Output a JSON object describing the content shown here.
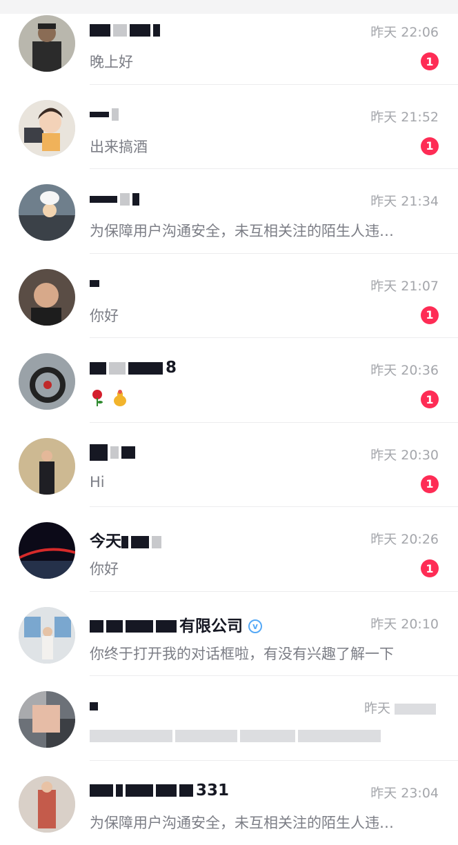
{
  "messages": [
    {
      "name_visible": "",
      "time": "昨天 22:06",
      "preview": "晚上好",
      "unread": "1"
    },
    {
      "name_visible": "",
      "time": "昨天 21:52",
      "preview": "出来搞酒",
      "unread": "1"
    },
    {
      "name_visible": "",
      "time": "昨天 21:34",
      "preview": "为保障用户沟通安全，未互相关注的陌生人违…",
      "unread": ""
    },
    {
      "name_visible": "",
      "time": "昨天 21:07",
      "preview": "你好",
      "unread": "1"
    },
    {
      "name_visible": "8",
      "time": "昨天 20:36",
      "preview": "",
      "unread": "1"
    },
    {
      "name_visible": "",
      "time": "昨天 20:30",
      "preview": "Hi",
      "unread": "1"
    },
    {
      "name_visible": "今天",
      "time": "昨天 20:26",
      "preview": "你好",
      "unread": "1"
    },
    {
      "name_visible": "有限公司",
      "time": "昨天 20:10",
      "preview": "你终于打开我的对话框啦，有没有兴趣了解一下",
      "unread": ""
    },
    {
      "name_visible": "",
      "time": "昨天",
      "preview": "",
      "unread": ""
    },
    {
      "name_visible": "331",
      "time": "昨天 23:04",
      "preview": "为保障用户沟通安全，未互相关注的陌生人违…",
      "unread": ""
    }
  ],
  "colors": {
    "badge": "#fe2c55",
    "time": "#a4a6ab",
    "preview": "#7b7d85",
    "verified": "#54a8f6"
  }
}
